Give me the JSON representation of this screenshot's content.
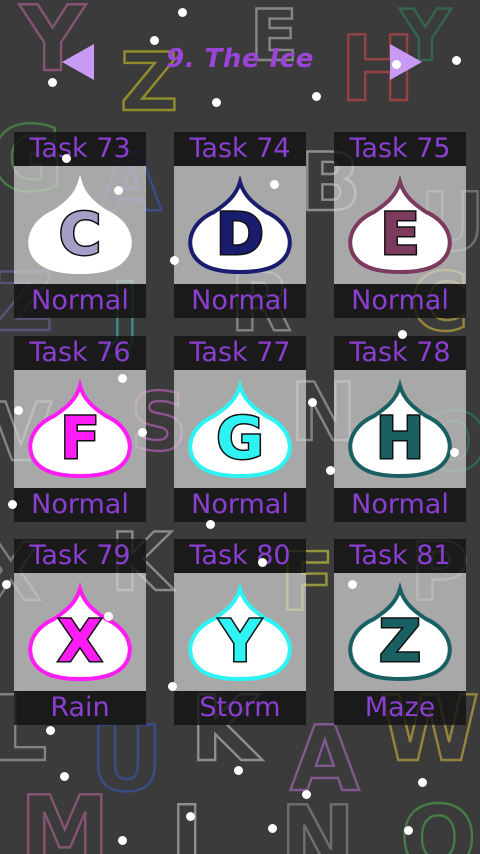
{
  "header": {
    "title": "9. The Ice",
    "prev_icon": "triangle-left-icon",
    "next_icon": "triangle-right-icon",
    "arrow_color": "#c79bf3"
  },
  "tasks": [
    {
      "label": "Task 73",
      "letter": "C",
      "mode": "Normal",
      "outline": "#ffffff",
      "letter_fill": "#a79ec8"
    },
    {
      "label": "Task 74",
      "letter": "D",
      "mode": "Normal",
      "outline": "#1a1c6e",
      "letter_fill": "#1a1c6e"
    },
    {
      "label": "Task 75",
      "letter": "E",
      "mode": "Normal",
      "outline": "#7b3a5e",
      "letter_fill": "#7b3a5e"
    },
    {
      "label": "Task 76",
      "letter": "F",
      "mode": "Normal",
      "outline": "#ff1cf5",
      "letter_fill": "#ff1cf5"
    },
    {
      "label": "Task 77",
      "letter": "G",
      "mode": "Normal",
      "outline": "#2ff3f3",
      "letter_fill": "#2ff3f3"
    },
    {
      "label": "Task 78",
      "letter": "H",
      "mode": "Normal",
      "outline": "#1a5f62",
      "letter_fill": "#1a5f62"
    },
    {
      "label": "Task 79",
      "letter": "X",
      "mode": "Rain",
      "outline": "#ff1cf5",
      "letter_fill": "#ff1cf5"
    },
    {
      "label": "Task 80",
      "letter": "Y",
      "mode": "Storm",
      "outline": "#2ff3f3",
      "letter_fill": "#2ff3f3"
    },
    {
      "label": "Task 81",
      "letter": "Z",
      "mode": "Maze",
      "outline": "#1a5f62",
      "letter_fill": "#1a5f62"
    }
  ]
}
